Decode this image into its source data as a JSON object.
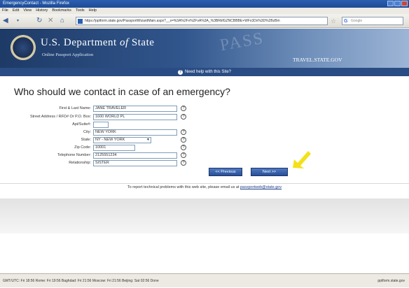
{
  "window": {
    "title": "EmergencyContact - Mozilla Firefox"
  },
  "menu": [
    "File",
    "Edit",
    "View",
    "History",
    "Bookmarks",
    "Tools",
    "Help"
  ],
  "nav": {
    "url": "https://pptform.state.gov/PassportWizardMain.aspx?__s=%3A%2Fv%2FvA%3A_%3BRkfGZNCBBBE+WFx3Dx%3D%2BzBm",
    "search_placeholder": "Google"
  },
  "header": {
    "dept_main": "U.S. Department",
    "dept_of": "of",
    "dept_state": "State",
    "subtitle": "Online Passport Application",
    "watermark": "PASS",
    "travel": "TRAVEL.STATE.GOV"
  },
  "helpbar": {
    "text": "Need help with this Site?"
  },
  "form": {
    "title": "Who should we contact in case of an emergency?",
    "fields": [
      {
        "label": "First & Last Name:",
        "value": "JANE TRAVELER"
      },
      {
        "label": "Street Address / RFD# Or P.O. Box:",
        "value": "1600 WORLD PL"
      },
      {
        "label": "Apt/Suite#:",
        "value": ""
      },
      {
        "label": "City:",
        "value": "NEW YORK"
      },
      {
        "label": "State:",
        "value": "NY - NEW YORK"
      },
      {
        "label": "Zip Code:",
        "value": "10001"
      },
      {
        "label": "Telephone Number:",
        "value": "2125551234"
      },
      {
        "label": "Relationship:",
        "value": "SISTER"
      }
    ],
    "previous_label": "<< Previous",
    "next_label": "Next >>"
  },
  "footer": {
    "report_text": "To report technical problems with this web site, please email us at",
    "report_link": "passportweb@state.gov"
  },
  "status": {
    "clocks": "GMT/UTC: Fri 18:56    Rome: Fri 19:56    Baghdad: Fri 21:56    Moscow: Fri 21:56    Beijing: Sat 02:56    Done",
    "domain": "pptform.state.gov"
  },
  "colors": {
    "header_dark": "#1e3a66",
    "helpbar": "#2a4c84",
    "button": "#284f97",
    "indicator_arrow": "#f3e11a"
  }
}
